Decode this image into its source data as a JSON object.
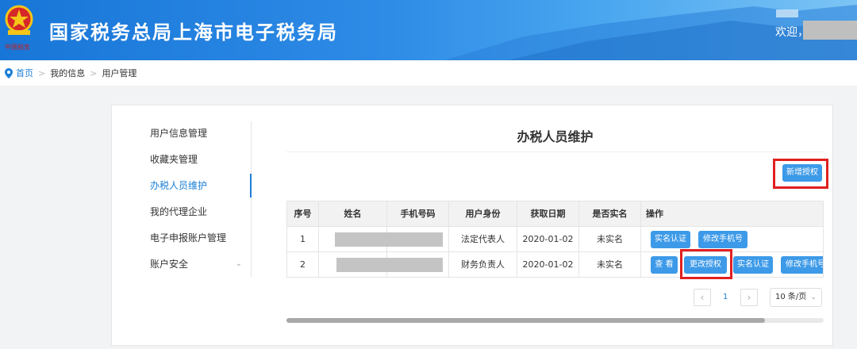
{
  "header": {
    "title": "国家税务总局上海市电子税务局",
    "welcome": "欢迎，"
  },
  "breadcrumb": {
    "home": "首页",
    "items": [
      "我的信息",
      "用户管理"
    ],
    "separator": ">"
  },
  "menu": {
    "items": [
      {
        "label": "用户信息管理"
      },
      {
        "label": "收藏夹管理"
      },
      {
        "label": "办税人员维护",
        "active": true
      },
      {
        "label": "我的代理企业"
      },
      {
        "label": "电子申报账户管理"
      },
      {
        "label": "账户安全",
        "has_submenu": true
      }
    ]
  },
  "content": {
    "title": "办税人员维护",
    "add_button": "新增授权"
  },
  "table": {
    "columns": [
      "序号",
      "姓名",
      "手机号码",
      "用户身份",
      "获取日期",
      "是否实名",
      "操作"
    ],
    "rows": [
      {
        "index": "1",
        "name": "",
        "phone": "",
        "role": "法定代表人",
        "date": "2020-01-02",
        "verified": "未实名",
        "actions": [
          "实名认证",
          "修改手机号"
        ]
      },
      {
        "index": "2",
        "name": "",
        "phone": "",
        "role": "财务负责人",
        "date": "2020-01-02",
        "verified": "未实名",
        "actions": [
          "查 看",
          "更改授权",
          "实名认证",
          "修改手机号"
        ]
      }
    ]
  },
  "pagination": {
    "prev": "‹",
    "current_page": "1",
    "next": "›",
    "page_size": "10 条/页"
  },
  "colors": {
    "accent": "#1a7ed6",
    "button": "#3d9ae8",
    "highlight": "#e02020",
    "header_start": "#1876d8"
  },
  "icons": {
    "breadcrumb": "location-pin-icon",
    "emblem": "tax-emblem-icon"
  }
}
